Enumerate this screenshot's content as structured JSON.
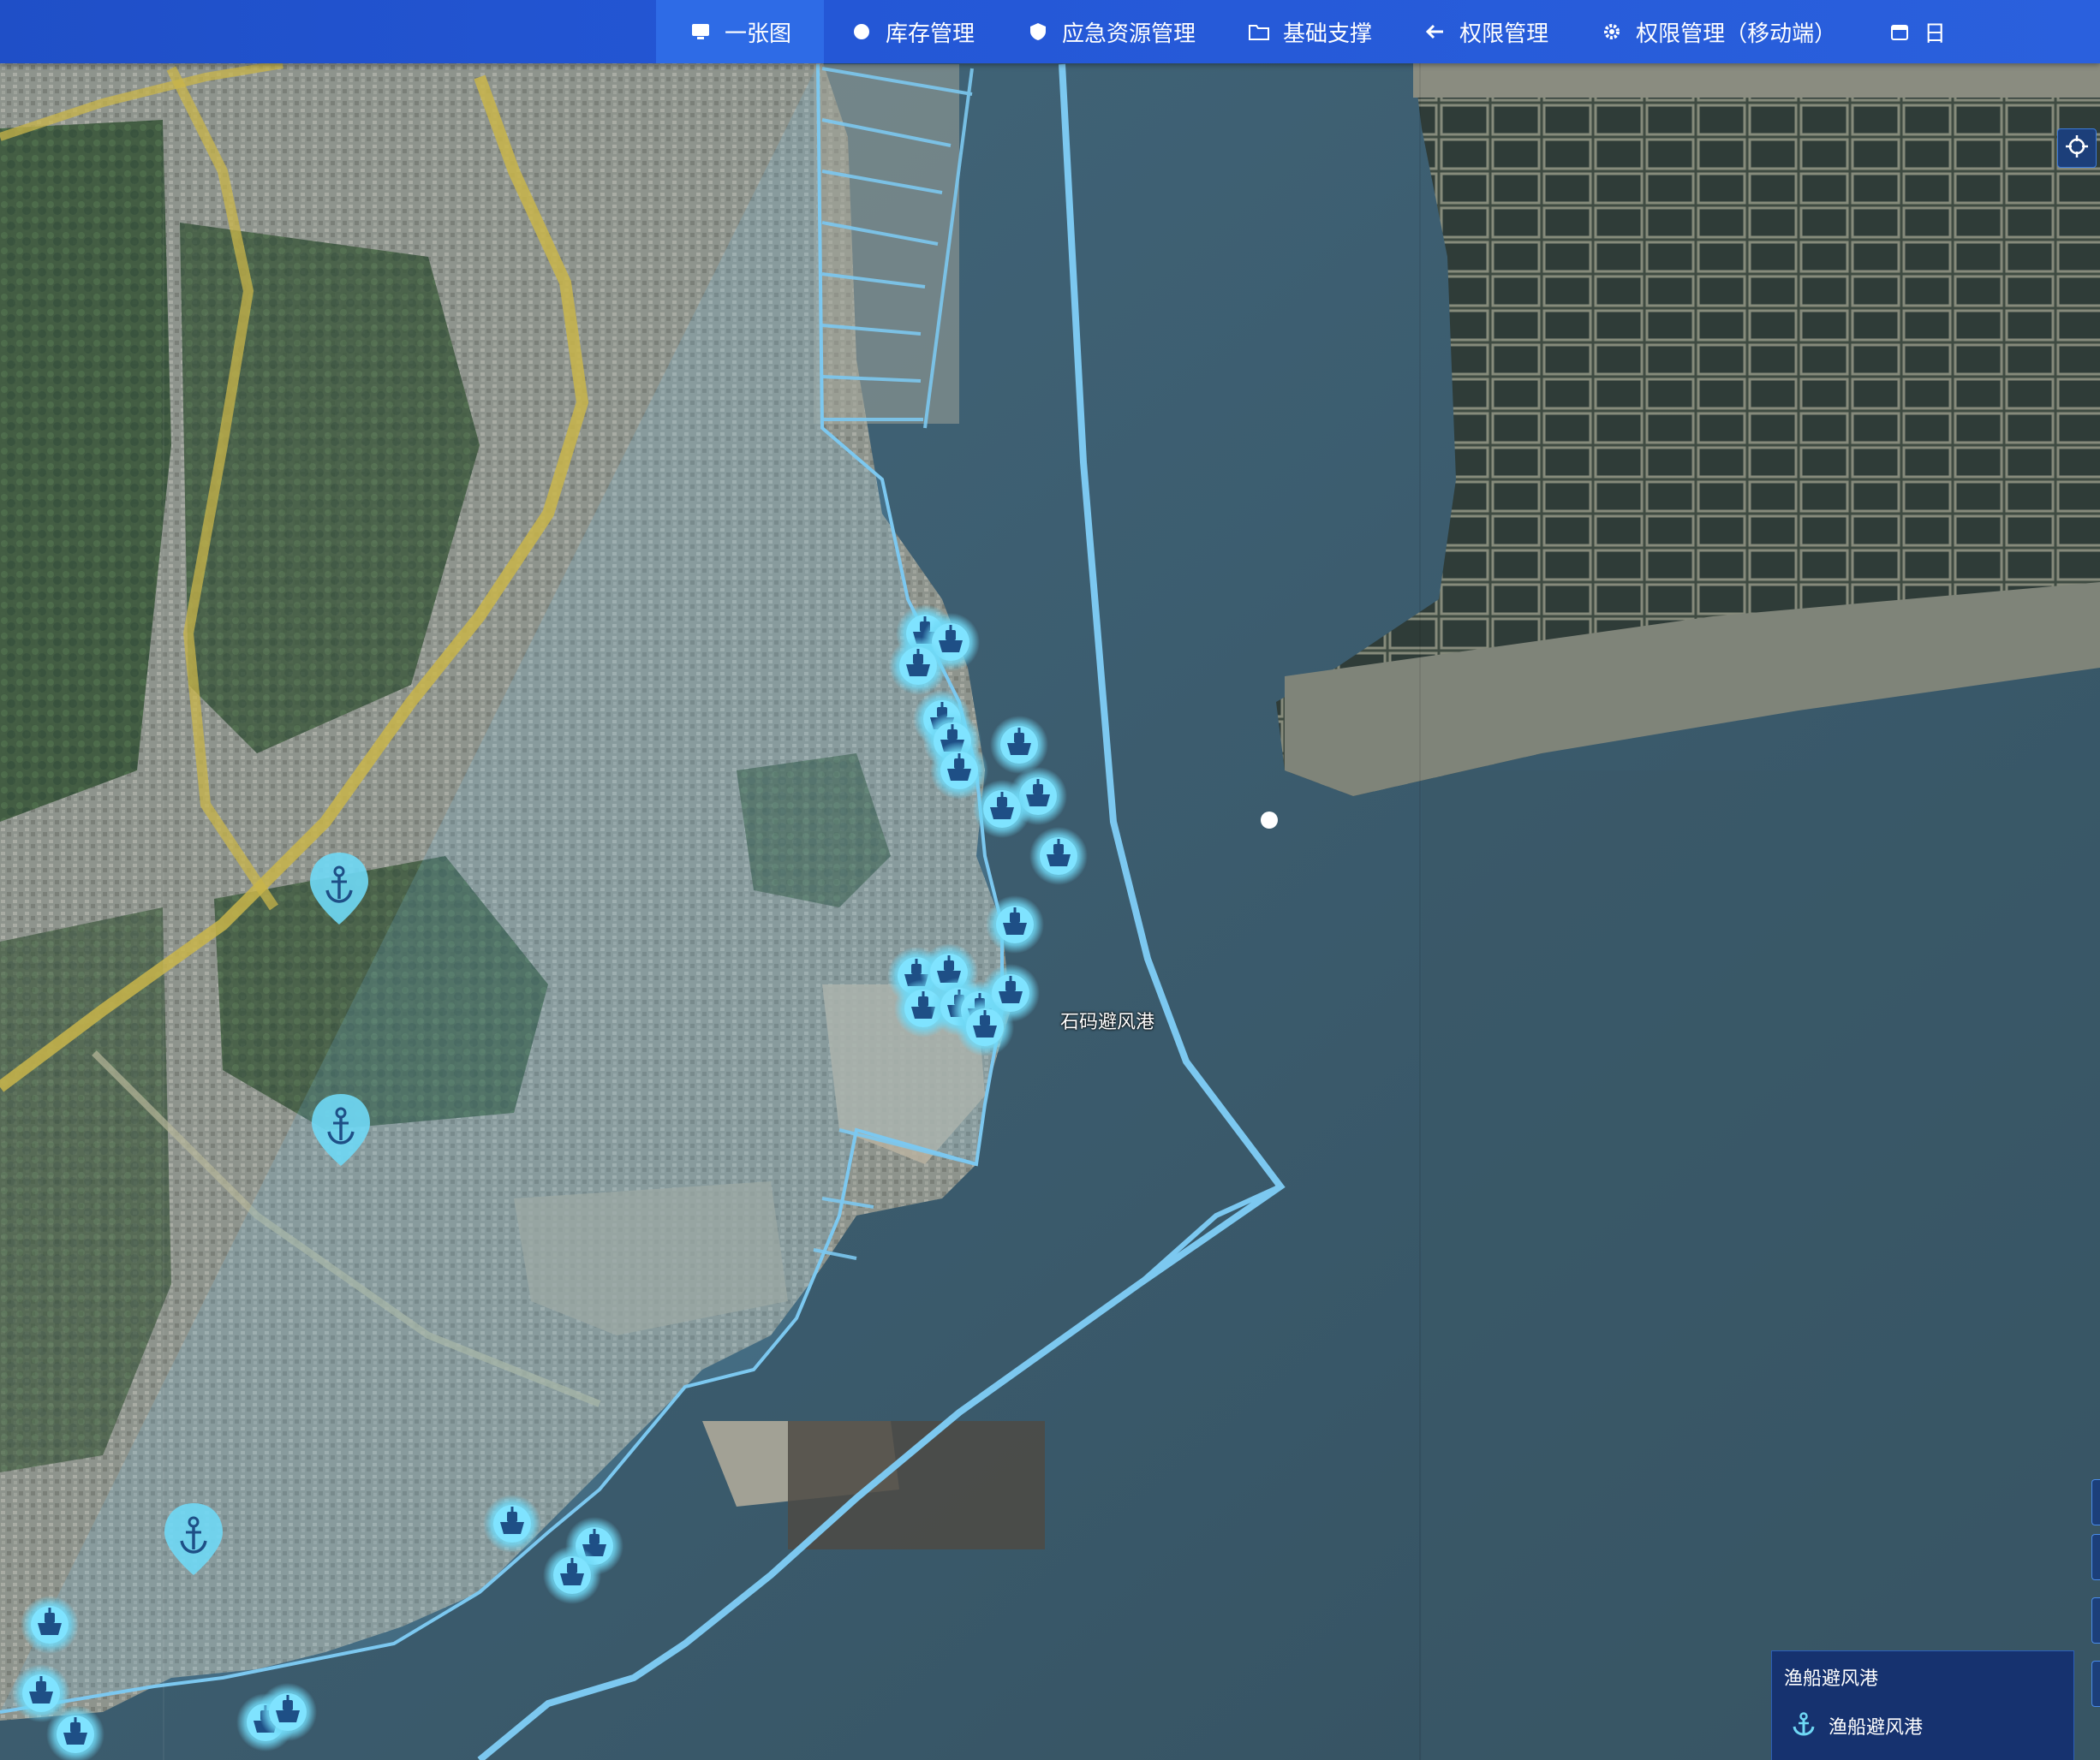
{
  "nav": {
    "items": [
      {
        "label": "一张图",
        "icon": "monitor-icon",
        "active": true
      },
      {
        "label": "库存管理",
        "icon": "circle-icon",
        "active": false
      },
      {
        "label": "应急资源管理",
        "icon": "shield-icon",
        "active": false
      },
      {
        "label": "基础支撑",
        "icon": "folder-icon",
        "active": false
      },
      {
        "label": "权限管理",
        "icon": "arrow-left-icon",
        "active": false
      },
      {
        "label": "权限管理（移动端）",
        "icon": "gear-icon",
        "active": false
      },
      {
        "label": "日",
        "icon": "calendar-icon",
        "active": false
      }
    ]
  },
  "map": {
    "harbor_label": "石码避风港",
    "colors": {
      "boundary": "#7cc8f0",
      "marker_glow": "#7fe3ff",
      "marker_fill": "#1e4f86",
      "sea": "#3b5a6e",
      "land": "#6f7c72"
    },
    "marker_icon": "ship-icon",
    "anchorage_icon": "anchor-icon"
  },
  "legend": {
    "title": "渔船避风港",
    "item_label": "渔船避风港",
    "item_icon": "anchor-icon"
  },
  "tools": {
    "locate_icon": "crosshair-icon"
  }
}
